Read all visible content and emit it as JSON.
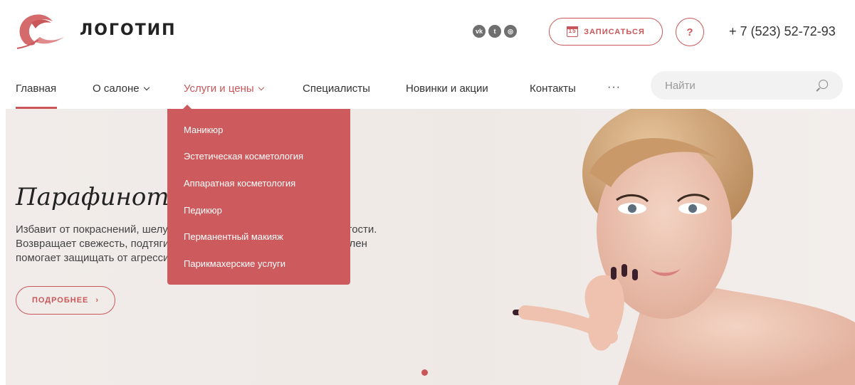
{
  "header": {
    "logo_text": "ЛОГОТИП",
    "social": [
      {
        "icon": "vk-icon",
        "glyph": "vk"
      },
      {
        "icon": "twitter-icon",
        "glyph": "t"
      },
      {
        "icon": "instagram-icon",
        "glyph": "◎"
      }
    ],
    "book_label": "ЗАПИСАТЬСЯ",
    "book_calendar_day": "15",
    "help_label": "?",
    "phone": "+ 7 (523) 52-72-93"
  },
  "nav": {
    "home": "Главная",
    "about": "О салоне",
    "services": "Услуги и цены",
    "specialists": "Специалисты",
    "news": "Новинки и акции",
    "contacts": "Контакты",
    "more": "···",
    "search_placeholder": "Найти"
  },
  "dropdown": {
    "items": [
      "Маникюр",
      "Эстетическая косметология",
      "Аппаратная косметология",
      "Педикюр",
      "Перманентный макияж",
      "Парикмахерские услуги"
    ]
  },
  "hero": {
    "title": "Парафинотерапия",
    "lines": [
      "Избавит от покраснений, шелушения и сухости, придает коже упругости.",
      "Возвращает свежесть, подтягивает кожу. Содержащийся в нем Азулен",
      "помогает защищать от агрессивного воздействия внешней среды."
    ],
    "button_label": "ПОДРОБНЕЕ",
    "button_arrow": "›"
  },
  "colors": {
    "accent": "#c9575a",
    "dropdown_bg": "#cd5a5c"
  }
}
